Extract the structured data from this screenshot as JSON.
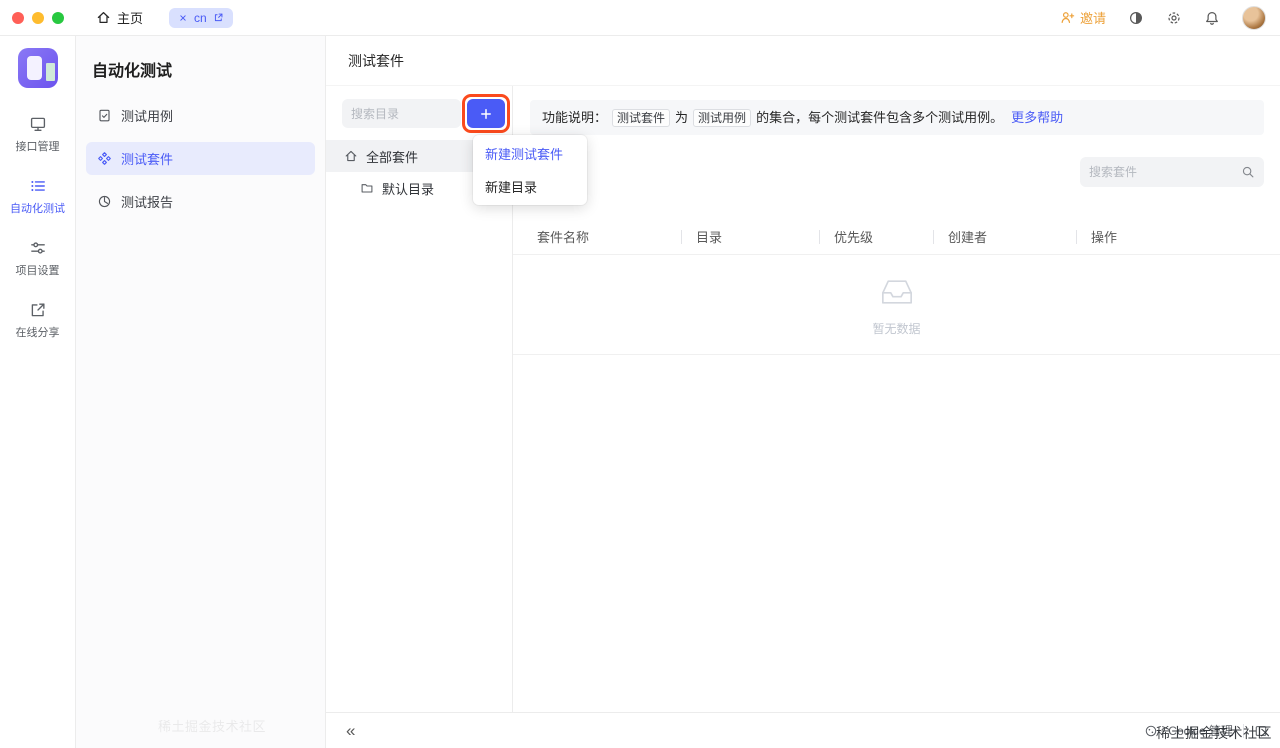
{
  "colors": {
    "accent": "#4a5bf6",
    "annotation": "#fb4a1d",
    "invite": "#eda23b",
    "active_item_bg": "#e8ebfd",
    "tab_bg": "#d9e0fe"
  },
  "titlebar": {
    "home_label": "主页",
    "tab_label": "cn",
    "invite_label": "邀请"
  },
  "primary_sidebar": {
    "items": [
      {
        "label": "接口管理"
      },
      {
        "label": "自动化测试"
      },
      {
        "label": "项目设置"
      },
      {
        "label": "在线分享"
      }
    ]
  },
  "secondary_sidebar": {
    "title": "自动化测试",
    "items": [
      {
        "label": "测试用例"
      },
      {
        "label": "测试套件"
      },
      {
        "label": "测试报告"
      }
    ]
  },
  "main": {
    "header_title": "测试套件",
    "tree_panel": {
      "search_placeholder": "搜索目录",
      "nodes": [
        {
          "label": "全部套件"
        },
        {
          "label": "默认目录"
        }
      ],
      "menu_items": [
        {
          "label": "新建测试套件"
        },
        {
          "label": "新建目录"
        }
      ]
    },
    "banner": {
      "prefix": "功能说明：",
      "tag1": "测试套件",
      "mid1": "为",
      "tag2": "测试用例",
      "mid2": "的集合，每个测试套件包含多个测试用例。",
      "link": "更多帮助"
    },
    "content": {
      "search_placeholder": "搜索套件",
      "table_headers": [
        "套件名称",
        "目录",
        "优先级",
        "创建者",
        "操作"
      ],
      "empty_text": "暂无数据"
    }
  },
  "bottom_bar": {
    "collapse": "«",
    "cookie_label": "Cookie 管理"
  },
  "watermark": {
    "text": "稀土掘金技术社区"
  }
}
